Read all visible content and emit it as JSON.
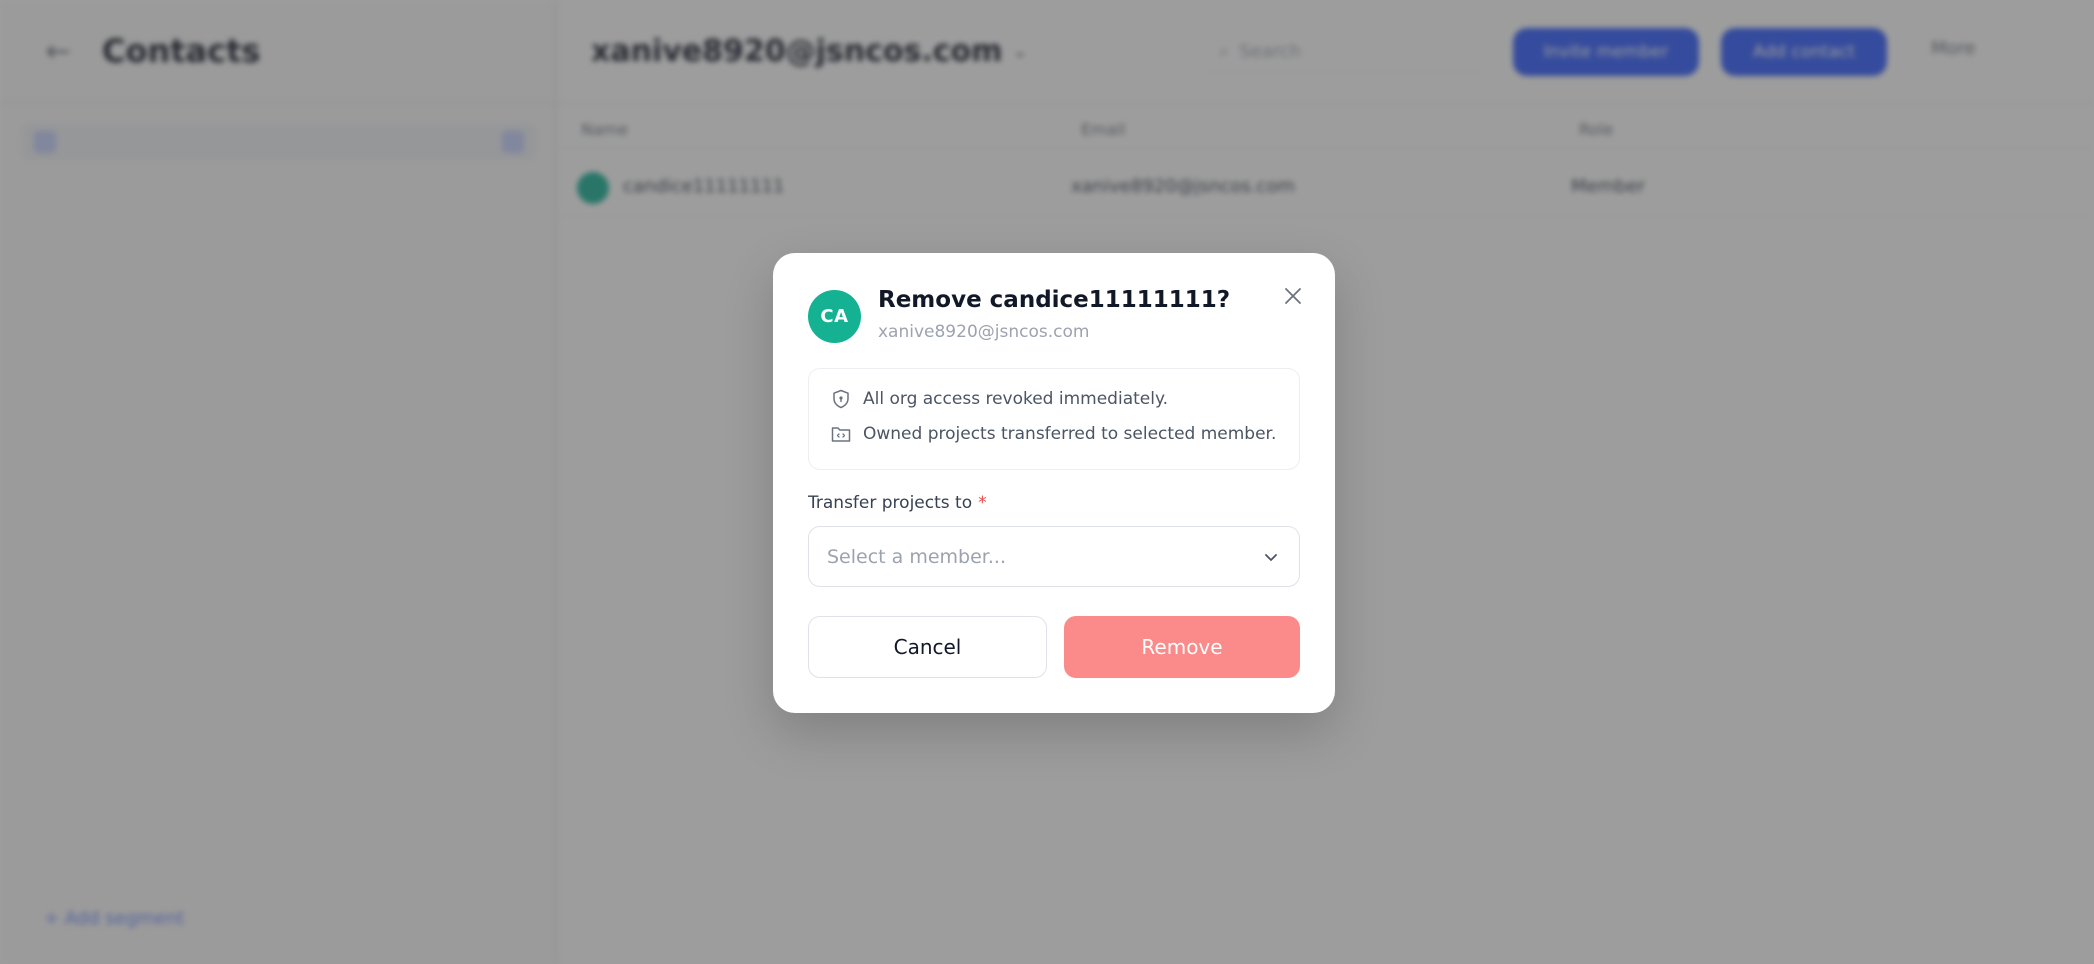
{
  "background": {
    "sidebar": {
      "title": "Contacts",
      "footer_link": "+ Add segment"
    },
    "header": {
      "account": "xanive8920@jsncos.com",
      "search_placeholder": "Search",
      "primary_button_1": "Invite member",
      "primary_button_2": "Add contact",
      "more_label": "More"
    },
    "table": {
      "columns": [
        "Name",
        "Email",
        "Role"
      ],
      "rows": [
        {
          "name": "candice11111111",
          "email": "xanive8920@jsncos.com",
          "role": "Member"
        }
      ]
    }
  },
  "modal": {
    "avatar_initials": "CA",
    "title": "Remove candice11111111?",
    "email": "xanive8920@jsncos.com",
    "info": [
      "All org access revoked immediately.",
      "Owned projects transferred to selected member."
    ],
    "transfer_label": "Transfer projects to",
    "required_mark": "*",
    "select_placeholder": "Select a member...",
    "cancel_label": "Cancel",
    "remove_label": "Remove"
  },
  "colors": {
    "avatar": "#14b292",
    "remove_button": "#fb8a8a",
    "required": "#ef4444",
    "primary_blue": "#2f5bff"
  },
  "icons": [
    "close-icon",
    "shield-icon",
    "folder-icon",
    "chevron-down-icon"
  ]
}
